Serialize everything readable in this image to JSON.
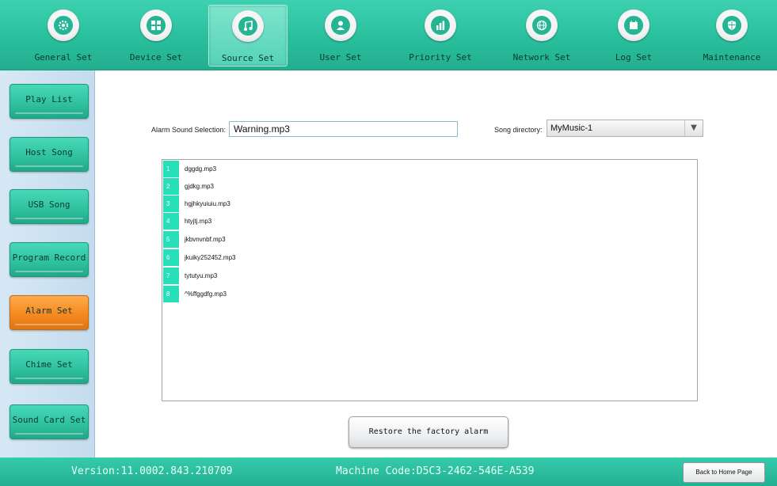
{
  "nav": {
    "items": [
      {
        "label": "General Set",
        "icon": "gear-icon"
      },
      {
        "label": "Device Set",
        "icon": "grid-icon"
      },
      {
        "label": "Source Set",
        "icon": "music-note-icon",
        "active": true
      },
      {
        "label": "User Set",
        "icon": "user-icon"
      },
      {
        "label": "Priority Set",
        "icon": "bar-chart-icon"
      },
      {
        "label": "Network Set",
        "icon": "globe-icon"
      },
      {
        "label": "Log Set",
        "icon": "calendar-icon"
      },
      {
        "label": "Maintenance",
        "icon": "shield-icon"
      }
    ]
  },
  "sidebar": {
    "items": [
      {
        "label": "Play List"
      },
      {
        "label": "Host Song"
      },
      {
        "label": "USB Song"
      },
      {
        "label": "Program Record"
      },
      {
        "label": "Alarm Set",
        "active": true
      },
      {
        "label": "Chime Set"
      },
      {
        "label": "Sound Card Set"
      }
    ]
  },
  "main": {
    "alarm_label": "Alarm Sound Selection:",
    "alarm_value": "Warning.mp3",
    "dir_label": "Song directory:",
    "dir_value": "MyMusic-1",
    "songs": [
      {
        "num": "1",
        "name": "dggdg.mp3"
      },
      {
        "num": "2",
        "name": "gjdkg.mp3"
      },
      {
        "num": "3",
        "name": "hgjhkyuiuiu.mp3"
      },
      {
        "num": "4",
        "name": "htyjtj.mp3"
      },
      {
        "num": "5",
        "name": "jkbvnvnbf.mp3"
      },
      {
        "num": "6",
        "name": "jkuiky252452.mp3"
      },
      {
        "num": "7",
        "name": "tytutyu.mp3"
      },
      {
        "num": "8",
        "name": "^%ffggdfg.mp3"
      }
    ],
    "restore_label": "Restore the factory alarm"
  },
  "footer": {
    "version": "Version:11.0002.843.210709",
    "machine_code": "Machine Code:D5C3-2462-546E-A539",
    "home_label": "Back to Home Page"
  },
  "colors": {
    "accent": "#29bf9d",
    "active_tab": "#ff9a2e",
    "list_number_bg": "#27e0b9"
  }
}
